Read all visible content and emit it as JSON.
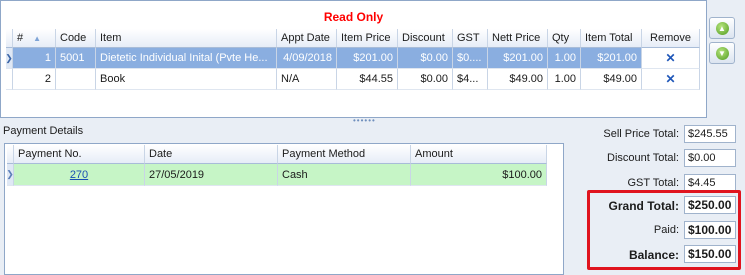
{
  "items_grid": {
    "banner": "Read Only",
    "columns": [
      "#",
      "Code",
      "Item",
      "Appt Date",
      "Item Price",
      "Discount",
      "GST",
      "Nett Price",
      "Qty",
      "Item Total",
      "Remove"
    ],
    "rows": [
      {
        "num": "1",
        "code": "5001",
        "item": "Dietetic Individual Inital (Pvte He...",
        "appt_date": "4/09/2018",
        "item_price": "$201.00",
        "discount": "$0.00",
        "gst": "$0....",
        "nett_price": "$201.00",
        "qty": "1.00",
        "item_total": "$201.00",
        "selected": true
      },
      {
        "num": "2",
        "code": "",
        "item": "Book",
        "appt_date": "N/A",
        "item_price": "$44.55",
        "discount": "$0.00",
        "gst": "$4...",
        "nett_price": "$49.00",
        "qty": "1.00",
        "item_total": "$49.00",
        "selected": false
      }
    ]
  },
  "side_buttons": [
    "move-up-icon",
    "move-down-icon"
  ],
  "payment_details": {
    "title": "Payment Details",
    "columns": [
      "Payment No.",
      "Date",
      "Payment Method",
      "Amount"
    ],
    "rows": [
      {
        "payment_no": "270",
        "date": "27/05/2019",
        "method": "Cash",
        "amount": "$100.00"
      }
    ]
  },
  "totals": {
    "sell_price_label": "Sell Price Total:",
    "sell_price_value": "$245.55",
    "discount_label": "Discount Total:",
    "discount_value": "$0.00",
    "gst_label": "GST Total:",
    "gst_value": "$4.45",
    "grand_label": "Grand Total:",
    "grand_value": "$250.00",
    "paid_label": "Paid:",
    "paid_value": "$100.00",
    "balance_label": "Balance:",
    "balance_value": "$150.00"
  },
  "colors": {
    "banner": "#ff0000",
    "selected_row": "#8aaee0",
    "payment_row": "#c6f5c6",
    "highlight": "#e0141e"
  }
}
